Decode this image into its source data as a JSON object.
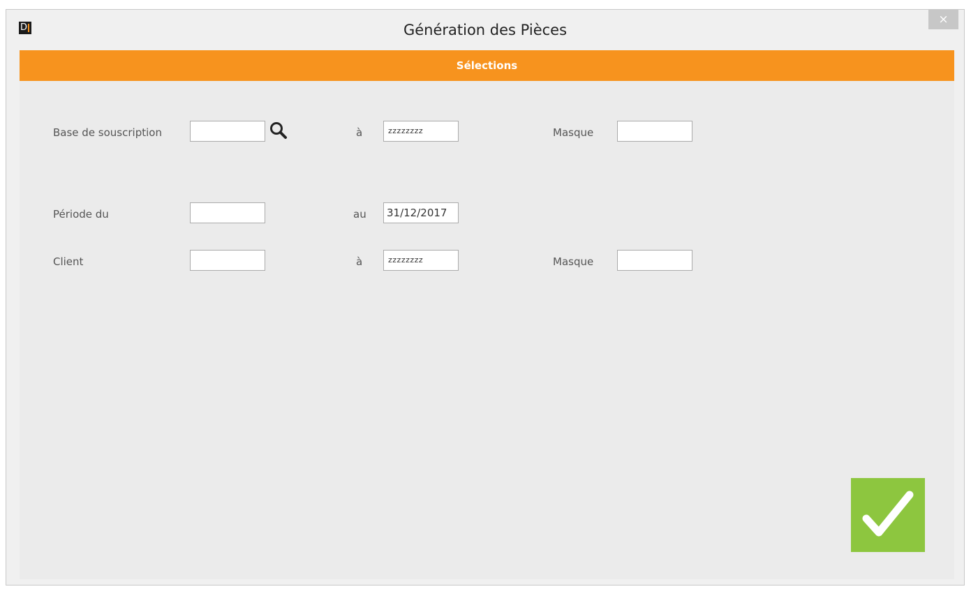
{
  "window": {
    "title": "Génération des Pièces",
    "logo_text": "D",
    "close_label": "×"
  },
  "section": {
    "header": "Sélections"
  },
  "form": {
    "base": {
      "label": "Base de souscription",
      "from_value": "",
      "to_label": "à",
      "to_value": "zzzzzzzz",
      "mask_label": "Masque",
      "mask_value": ""
    },
    "periode": {
      "label": "Période du",
      "from_value": "",
      "to_label": "au",
      "to_value": "31/12/2017"
    },
    "client": {
      "label": "Client",
      "from_value": "",
      "to_label": "à",
      "to_value": "zzzzzzzz",
      "mask_label": "Masque",
      "mask_value": ""
    }
  },
  "icons": {
    "search": "search-icon",
    "validate": "checkmark-icon",
    "close": "close-icon"
  },
  "colors": {
    "accent": "#f7931e",
    "validate": "#8dc63f"
  }
}
